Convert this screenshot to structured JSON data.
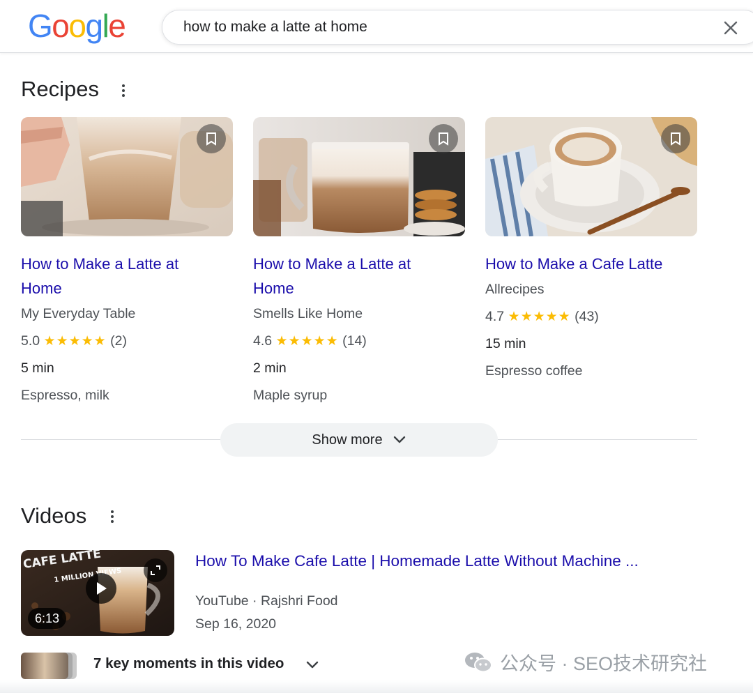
{
  "search": {
    "query": "how to make a latte at home",
    "logo_letters": [
      "G",
      "o",
      "o",
      "g",
      "l",
      "e"
    ]
  },
  "colors": {
    "link": "#1a0dab",
    "star": "#fbbc04",
    "text": "#202124",
    "muted": "#4d5156",
    "logo": [
      "#4285f4",
      "#ea4335",
      "#fbbc05",
      "#4285f4",
      "#34a853",
      "#ea4335"
    ]
  },
  "recipes": {
    "title": "Recipes",
    "cards": [
      {
        "title_line1": "How to Make a Latte at",
        "title_line2": "Home",
        "source": "My Everyday Table",
        "rating": "5.0",
        "stars": "★★★★★",
        "reviews": "(2)",
        "time": "5 min",
        "ingredients": "Espresso, milk"
      },
      {
        "title_line1": "How to Make a Latte at",
        "title_line2": "Home",
        "source": "Smells Like Home",
        "rating": "4.6",
        "stars": "★★★★★",
        "reviews": "(14)",
        "time": "2 min",
        "ingredients": "Maple syrup"
      },
      {
        "title_line1": "How to Make a Cafe Latte",
        "title_line2": "",
        "source": "Allrecipes",
        "rating": "4.7",
        "stars": "★★★★★",
        "reviews": "(43)",
        "time": "15 min",
        "ingredients": "Espresso coffee"
      }
    ],
    "show_more": "Show more"
  },
  "videos": {
    "title": "Videos",
    "item": {
      "title": "How To Make Cafe Latte | Homemade Latte Without Machine ...",
      "source": "YouTube · Rajshri Food",
      "date": "Sep 16, 2020",
      "duration": "6:13",
      "thumb_text_1": "CAFE LATTE",
      "thumb_text_2": "1 MILLION VIEWS"
    },
    "key_moments": "7 key moments in this video"
  },
  "watermark": "公众号 · SEO技术研究社"
}
